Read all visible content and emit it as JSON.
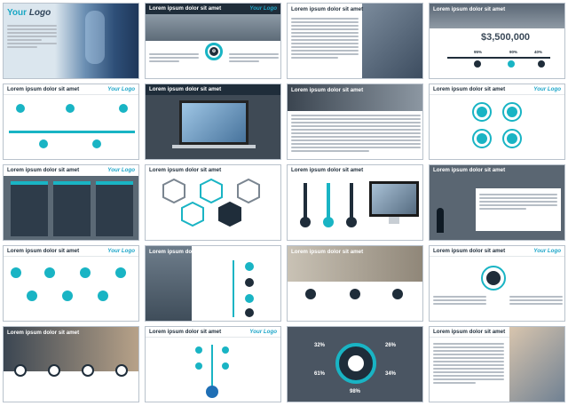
{
  "slide_title": "Lorem ipsum dolor sit amet",
  "logo_text": "Your Logo",
  "cover": {
    "logo_your": "Your",
    "logo_word": "Logo"
  },
  "slide4": {
    "amount": "$3,500,000",
    "pcts": [
      "95%",
      "90%",
      "40%"
    ]
  },
  "slide23": {
    "pcts": [
      "32%",
      "26%",
      "61%",
      "34%",
      "98%"
    ]
  },
  "colors": {
    "accent": "#19b4c4",
    "navy": "#1f2d3a",
    "logo_blue": "#1ea6c9"
  }
}
